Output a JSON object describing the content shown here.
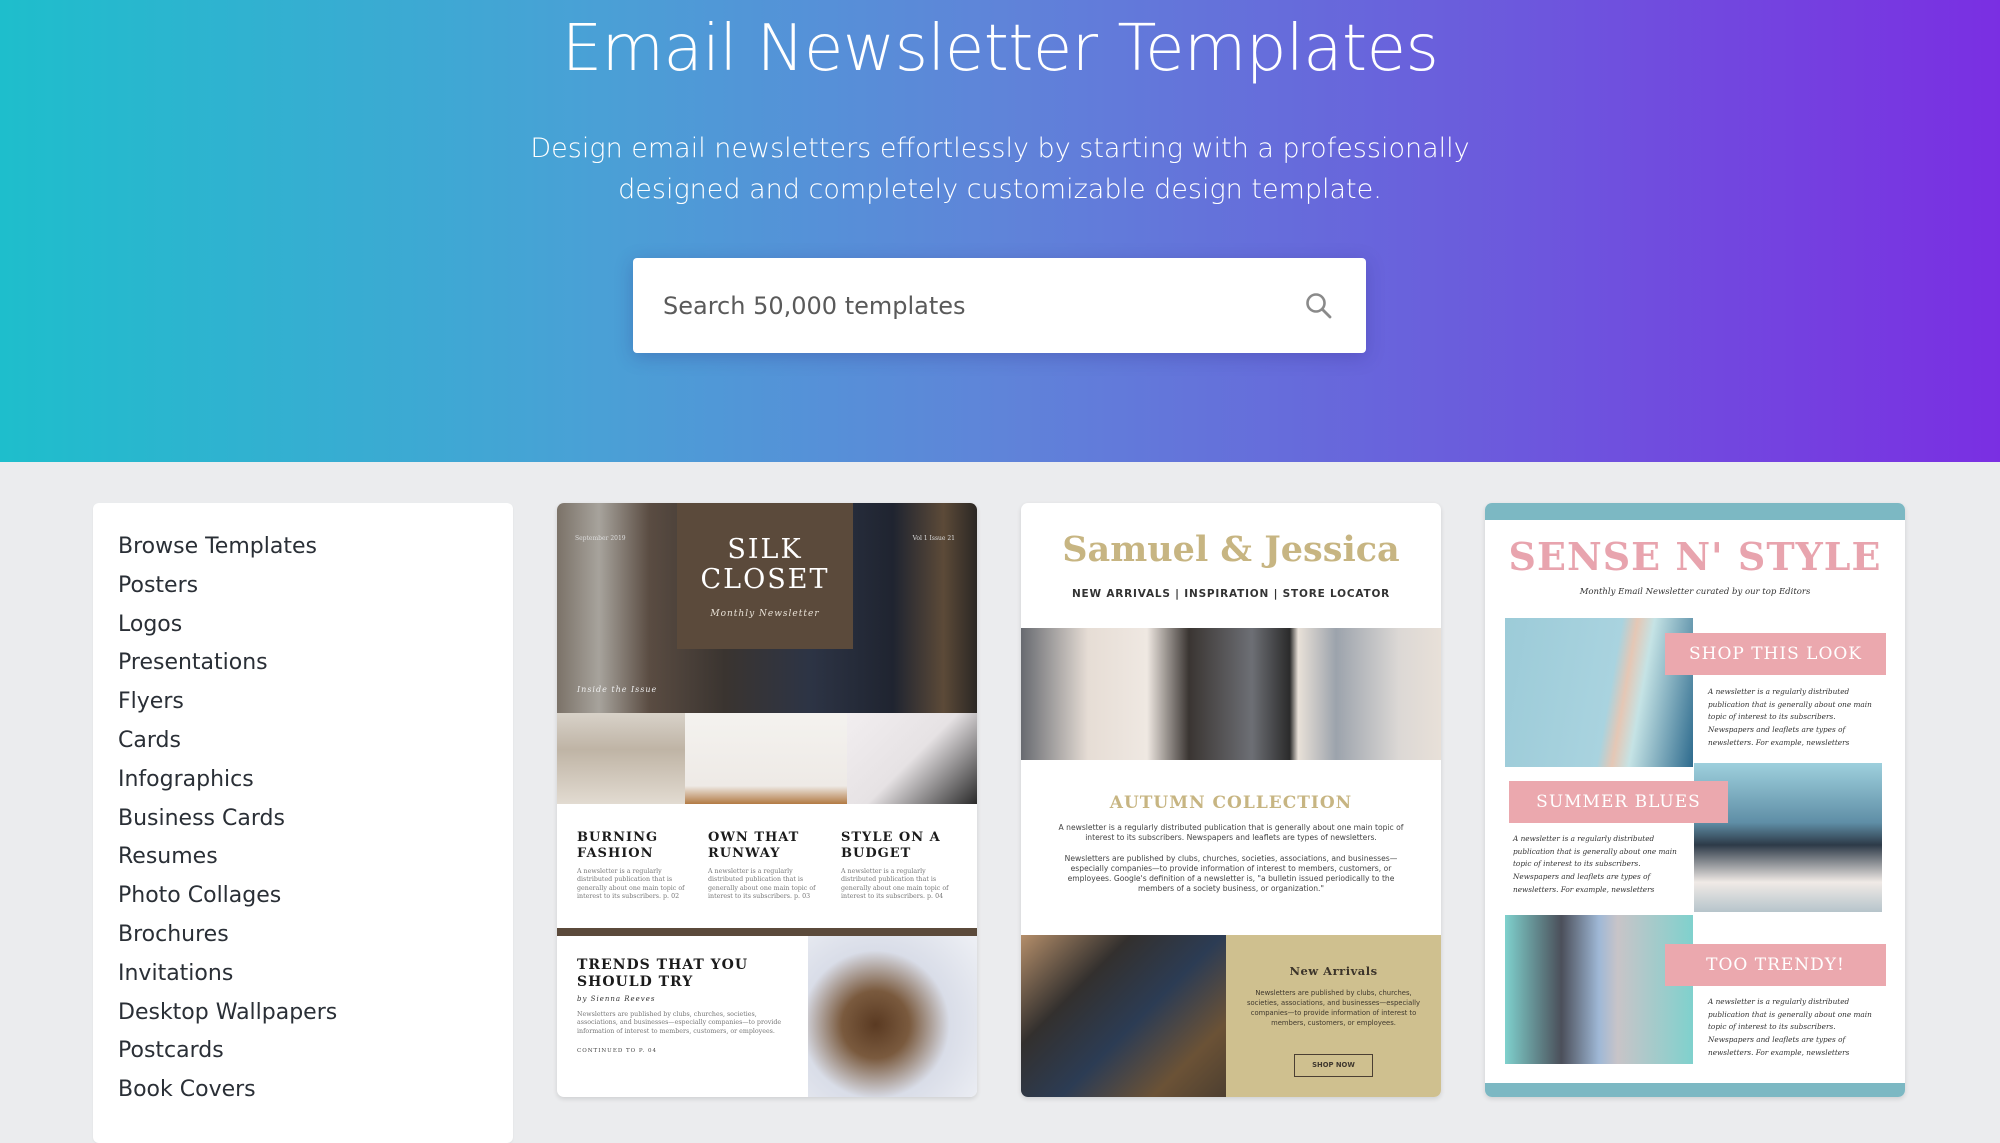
{
  "hero": {
    "title": "Email Newsletter Templates",
    "subtitle": "Design email newsletters effortlessly by starting with a professionally designed and completely customizable design template.",
    "search_placeholder": "Search 50,000 templates",
    "search_icon": "search-icon"
  },
  "colors": {
    "gradient_start": "#1ebecc",
    "gradient_end": "#7a2fe2",
    "page_background": "#ebecee"
  },
  "sidebar": {
    "items": [
      {
        "label": "Browse Templates"
      },
      {
        "label": "Posters"
      },
      {
        "label": "Logos"
      },
      {
        "label": "Presentations"
      },
      {
        "label": "Flyers"
      },
      {
        "label": "Cards"
      },
      {
        "label": "Infographics"
      },
      {
        "label": "Business Cards"
      },
      {
        "label": "Resumes"
      },
      {
        "label": "Photo Collages"
      },
      {
        "label": "Brochures"
      },
      {
        "label": "Invitations"
      },
      {
        "label": "Desktop Wallpapers"
      },
      {
        "label": "Postcards"
      },
      {
        "label": "Book Covers"
      }
    ]
  },
  "templates": [
    {
      "name": "Silk Closet",
      "date": "September 2019",
      "issue": "Vol 1 Issue 21",
      "title_line1": "SILK",
      "title_line2": "CLOSET",
      "tagline": "Monthly Newsletter",
      "inside": "Inside the Issue",
      "columns": [
        {
          "heading": "BURNING FASHION",
          "body": "A newsletter is a regularly distributed publication that is generally about one main topic of interest to its subscribers. p. 02"
        },
        {
          "heading": "OWN THAT RUNWAY",
          "body": "A newsletter is a regularly distributed publication that is generally about one main topic of interest to its subscribers. p. 03"
        },
        {
          "heading": "STYLE ON A BUDGET",
          "body": "A newsletter is a regularly distributed publication that is generally about one main topic of interest to its subscribers. p. 04"
        }
      ],
      "feature_heading": "TRENDS THAT YOU SHOULD TRY",
      "feature_byline": "by Sienna Reeves",
      "feature_body": "Newsletters are published by clubs, churches, societies, associations, and businesses—especially companies—to provide information of interest to members, customers, or employees.",
      "feature_continue": "CONTINUED TO P. 04"
    },
    {
      "name": "Samuel & Jessica",
      "nav": "NEW ARRIVALS | INSPIRATION | STORE LOCATOR",
      "section_heading": "AUTUMN COLLECTION",
      "para1": "A newsletter is a regularly distributed publication that is generally about one main topic of interest to its subscribers. Newspapers and leaflets are types of newsletters.",
      "para2": "Newsletters are published by clubs, churches, societies, associations, and businesses—especially companies—to provide information of interest to members, customers, or employees. Google's definition of a newsletter is, \"a bulletin issued periodically to the members of a society business, or organization.\"",
      "panel_heading": "New Arrivals",
      "panel_body": "Newsletters are published by clubs, churches, societies, associations, and businesses—especially companies—to provide information of interest to members, customers, or employees.",
      "panel_button": "SHOP NOW"
    },
    {
      "name": "SENSE N' STYLE",
      "tagline": "Monthly Email Newsletter curated by our top Editors",
      "sections": [
        {
          "label": "SHOP THIS LOOK",
          "body": "A newsletter is a regularly distributed publication that is generally about one main topic of interest to its subscribers. Newspapers and leaflets are types of newsletters. For example, newsletters"
        },
        {
          "label": "SUMMER BLUES",
          "body": "A newsletter is a regularly distributed publication that is generally about one main topic of interest to its subscribers. Newspapers and leaflets are types of newsletters. For example, newsletters"
        },
        {
          "label": "TOO TRENDY!",
          "body": "A newsletter is a regularly distributed publication that is generally about one main topic of interest to its subscribers. Newspapers and leaflets are types of newsletters. For example, newsletters"
        }
      ]
    }
  ]
}
